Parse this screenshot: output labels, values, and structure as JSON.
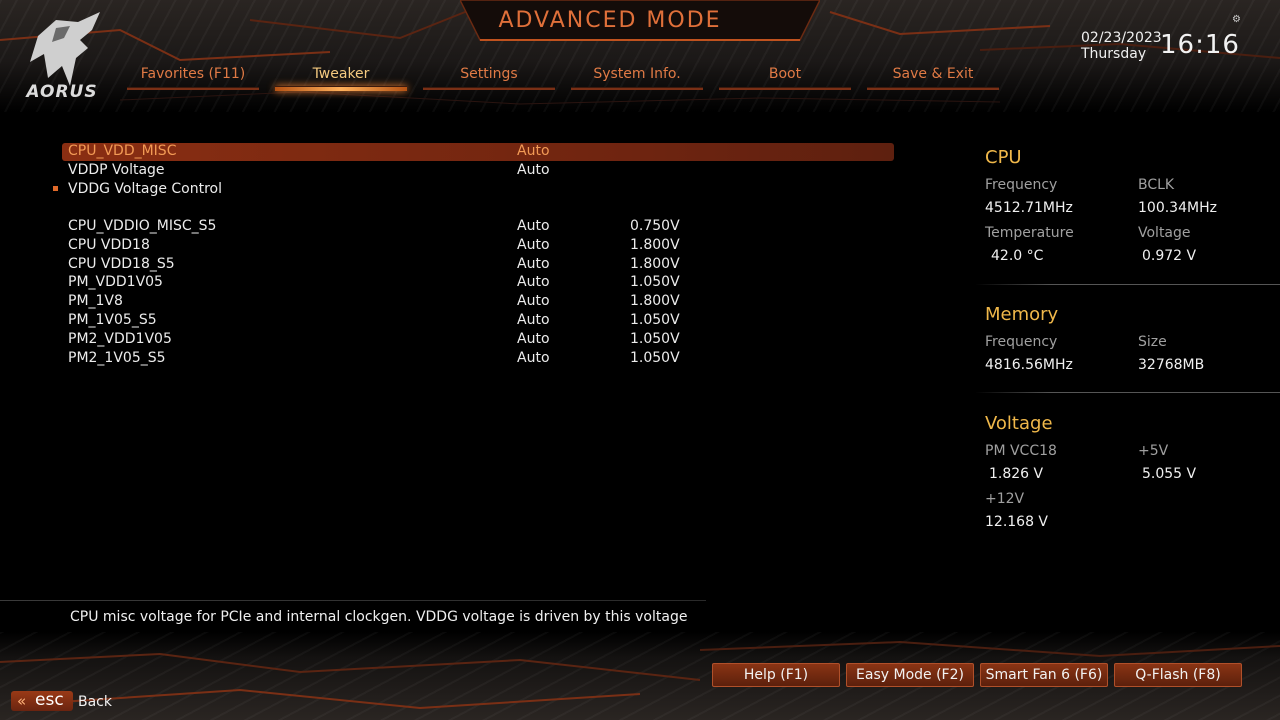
{
  "brand": "AORUS",
  "title": "ADVANCED MODE",
  "datetime": {
    "date": "02/23/2023",
    "day": "Thursday",
    "time": "16:16"
  },
  "tabs": [
    {
      "label": "Favorites (F11)"
    },
    {
      "label": "Tweaker"
    },
    {
      "label": "Settings"
    },
    {
      "label": "System Info."
    },
    {
      "label": "Boot"
    },
    {
      "label": "Save & Exit"
    }
  ],
  "active_tab": "Tweaker",
  "settings": [
    {
      "name": "CPU_VDD_MISC",
      "mode": "Auto",
      "value": ""
    },
    {
      "name": "VDDP Voltage",
      "mode": "Auto",
      "value": ""
    },
    {
      "name": "VDDG Voltage Control",
      "mode": "",
      "value": ""
    },
    {
      "name": "CPU_VDDIO_MISC_S5",
      "mode": "Auto",
      "value": "0.750V"
    },
    {
      "name": "CPU VDD18",
      "mode": "Auto",
      "value": "1.800V"
    },
    {
      "name": "CPU VDD18_S5",
      "mode": "Auto",
      "value": "1.800V"
    },
    {
      "name": "PM_VDD1V05",
      "mode": "Auto",
      "value": "1.050V"
    },
    {
      "name": "PM_1V8",
      "mode": "Auto",
      "value": "1.800V"
    },
    {
      "name": "PM_1V05_S5",
      "mode": "Auto",
      "value": "1.050V"
    },
    {
      "name": "PM2_VDD1V05",
      "mode": "Auto",
      "value": "1.050V"
    },
    {
      "name": "PM2_1V05_S5",
      "mode": "Auto",
      "value": "1.050V"
    }
  ],
  "monitor": {
    "cpu": {
      "heading": "CPU",
      "frequency_label": "Frequency",
      "frequency": "4512.71MHz",
      "bclk_label": "BCLK",
      "bclk": "100.34MHz",
      "temperature_label": "Temperature",
      "temperature": "42.0 °C",
      "voltage_label": "Voltage",
      "voltage": "0.972 V"
    },
    "memory": {
      "heading": "Memory",
      "frequency_label": "Frequency",
      "frequency": "4816.56MHz",
      "size_label": "Size",
      "size": "32768MB"
    },
    "voltage": {
      "heading": "Voltage",
      "pm_vcc18_label": "PM VCC18",
      "pm_vcc18": "1.826 V",
      "p5v_label": "+5V",
      "p5v": "5.055 V",
      "p12v_label": "+12V",
      "p12v": "12.168 V"
    }
  },
  "help_text": "CPU misc voltage for PCIe and internal clockgen. VDDG voltage is driven by this voltage",
  "footer": {
    "help": "Help (F1)",
    "easy_mode": "Easy Mode (F2)",
    "smart_fan": "Smart Fan 6 (F6)",
    "qflash": "Q-Flash (F8)",
    "esc": "esc",
    "back": "Back"
  },
  "colors": {
    "accent": "#e07a45",
    "active_tab": "#f4c97f",
    "monitor_heading": "#f0b84a",
    "selection": "#8a2e12"
  }
}
